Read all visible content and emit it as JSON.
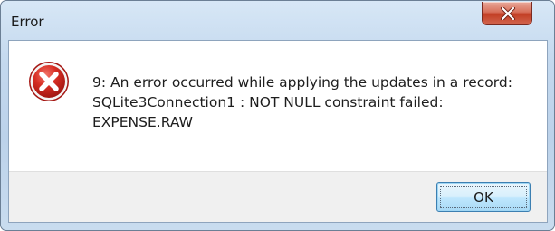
{
  "window": {
    "title": "Error"
  },
  "dialog": {
    "icon": "error-icon",
    "message": "9: An error occurred while applying the updates in a record: SQLite3Connection1 : NOT NULL constraint failed: EXPENSE.RAW",
    "ok_label": "OK"
  },
  "colors": {
    "close_button": "#c23e24",
    "error_icon": "#c9231d",
    "ok_button_border": "#3c7fb1"
  }
}
